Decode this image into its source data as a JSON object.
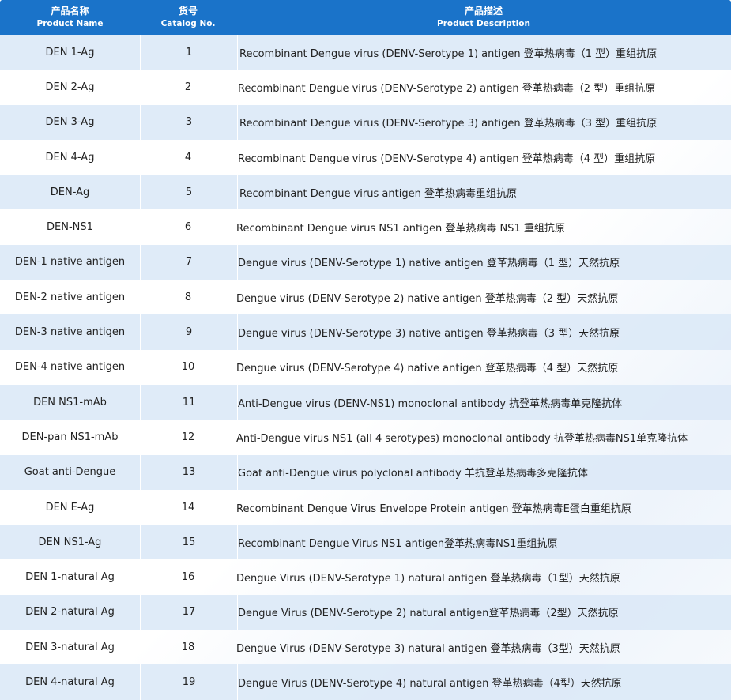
{
  "header": {
    "col1_zh": "产品名称",
    "col1_en": "Product Name",
    "col2_zh": "货号",
    "col2_en": "Catalog No.",
    "col3_zh": "产品描述",
    "col3_en": "Product Description"
  },
  "rows": [
    {
      "name": "DEN 1-Ag",
      "cat": "1",
      "desc": "Recombinant Dengue virus (DENV-Serotype 1) antigen 登革热病毒（1 型）重组抗原"
    },
    {
      "name": "DEN 2-Ag",
      "cat": "2",
      "desc": "Recombinant Dengue virus (DENV-Serotype 2) antigen 登革热病毒（2 型）重组抗原"
    },
    {
      "name": "DEN 3-Ag",
      "cat": "3",
      "desc": "Recombinant Dengue virus (DENV-Serotype 3) antigen 登革热病毒（3 型）重组抗原"
    },
    {
      "name": "DEN 4-Ag",
      "cat": "4",
      "desc": "Recombinant Dengue virus (DENV-Serotype 4) antigen 登革热病毒（4 型）重组抗原"
    },
    {
      "name": "DEN-Ag",
      "cat": "5",
      "desc": "Recombinant Dengue virus antigen 登革热病毒重组抗原"
    },
    {
      "name": "DEN-NS1",
      "cat": "6",
      "desc": "Recombinant Dengue virus NS1 antigen 登革热病毒 NS1 重组抗原"
    },
    {
      "name": "DEN-1 native antigen",
      "cat": "7",
      "desc": "Dengue virus  (DENV-Serotype 1) native antigen 登革热病毒（1 型）天然抗原"
    },
    {
      "name": "DEN-2 native antigen",
      "cat": "8",
      "desc": "Dengue virus  (DENV-Serotype 2) native antigen 登革热病毒（2 型）天然抗原"
    },
    {
      "name": "DEN-3 native antigen",
      "cat": "9",
      "desc": "Dengue virus  (DENV-Serotype 3) native antigen 登革热病毒（3 型）天然抗原"
    },
    {
      "name": "DEN-4 native antigen",
      "cat": "10",
      "desc": "Dengue virus  (DENV-Serotype 4) native antigen 登革热病毒（4 型）天然抗原"
    },
    {
      "name": "DEN NS1-mAb",
      "cat": "11",
      "desc": "Anti-Dengue virus (DENV-NS1) monoclonal antibody 抗登革热病毒单克隆抗体"
    },
    {
      "name": "DEN-pan NS1-mAb",
      "cat": "12",
      "desc": "Anti-Dengue virus NS1 (all 4 serotypes) monoclonal antibody 抗登革热病毒NS1单克隆抗体"
    },
    {
      "name": "Goat anti-Dengue",
      "cat": "13",
      "desc": "Goat anti-Dengue virus polyclonal antibody 羊抗登革热病毒多克隆抗体"
    },
    {
      "name": "DEN E-Ag",
      "cat": "14",
      "desc": "Recombinant Dengue Virus Envelope Protein antigen 登革热病毒E蛋白重组抗原"
    },
    {
      "name": "DEN NS1-Ag",
      "cat": "15",
      "desc": "Recombinant Dengue Virus NS1 antigen登革热病毒NS1重组抗原"
    },
    {
      "name": "DEN 1-natural Ag",
      "cat": "16",
      "desc": "Dengue Virus (DENV-Serotype 1) natural antigen 登革热病毒（1型）天然抗原"
    },
    {
      "name": "DEN 2-natural Ag",
      "cat": "17",
      "desc": "Dengue Virus (DENV-Serotype 2) natural antigen登革热病毒（2型）天然抗原"
    },
    {
      "name": "DEN 3-natural Ag",
      "cat": "18",
      "desc": "Dengue Virus (DENV-Serotype 3) natural antigen 登革热病毒（3型）天然抗原"
    },
    {
      "name": "DEN 4-natural Ag",
      "cat": "19",
      "desc": "Dengue Virus (DENV-Serotype 4) natural antigen 登革热病毒（4型）天然抗原"
    }
  ]
}
